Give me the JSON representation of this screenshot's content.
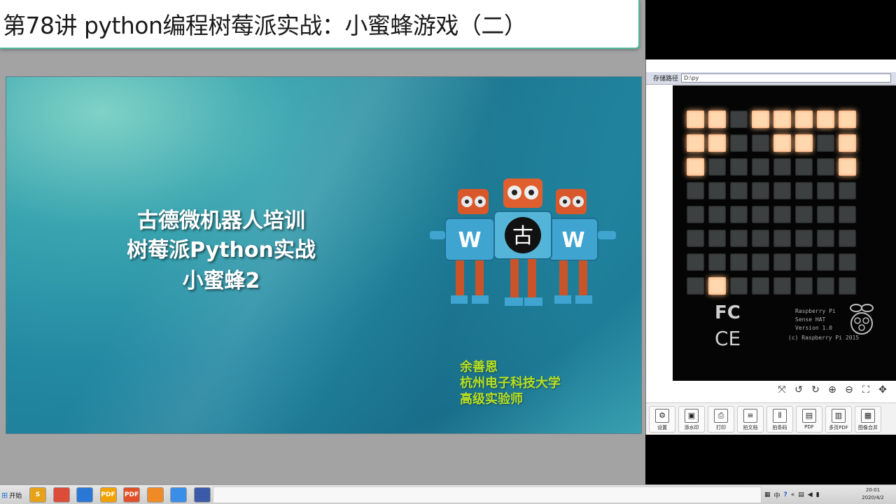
{
  "title_banner": {
    "text": "第78讲 python编程树莓派实战：小蜜蜂游戏（二）"
  },
  "slide": {
    "title_lines": [
      "古德微机器人培训",
      "树莓派Python实战",
      "小蜜蜂2"
    ],
    "author_lines": [
      "余善恩",
      "杭州电子科技大学",
      "高级实验师"
    ],
    "robot_badges": [
      "W",
      "古",
      "W"
    ]
  },
  "right_panel": {
    "path_label": "存储路径",
    "path_value": "D:\\py",
    "led_matrix": [
      [
        1,
        1,
        0,
        1,
        1,
        1,
        1,
        1
      ],
      [
        1,
        1,
        0,
        0,
        1,
        1,
        0,
        1
      ],
      [
        1,
        0,
        0,
        0,
        0,
        0,
        0,
        1
      ],
      [
        0,
        0,
        0,
        0,
        0,
        0,
        0,
        0
      ],
      [
        0,
        0,
        0,
        0,
        0,
        0,
        0,
        0
      ],
      [
        0,
        0,
        0,
        0,
        0,
        0,
        0,
        0
      ],
      [
        0,
        0,
        0,
        0,
        0,
        0,
        0,
        0
      ],
      [
        0,
        1,
        0,
        0,
        0,
        0,
        0,
        0
      ]
    ],
    "board_text": [
      "Raspberry Pi",
      "Sense HAT",
      "Version 1.0",
      "(c) Raspberry Pi 2015"
    ],
    "fcc_text": "FC",
    "ce_text": "CE",
    "view_tools": [
      "⤧",
      "↺",
      "↻",
      "⊕",
      "⊖",
      "⛶",
      "✥"
    ],
    "toolbar": [
      {
        "label": "设置",
        "icon": "gear-icon"
      },
      {
        "label": "添水印",
        "icon": "watermark-icon"
      },
      {
        "label": "打印",
        "icon": "printer-icon"
      },
      {
        "label": "拍文档",
        "icon": "document-icon"
      },
      {
        "label": "拍条码",
        "icon": "barcode-icon"
      },
      {
        "label": "PDF",
        "icon": "pdf-icon"
      },
      {
        "label": "多页PDF",
        "icon": "multipage-pdf-icon"
      },
      {
        "label": "图像合并",
        "icon": "merge-icon"
      }
    ]
  },
  "taskbar": {
    "start_label": "开始",
    "apps": [
      {
        "name": "sublime-icon",
        "label": "S",
        "color": "#e8a21a"
      },
      {
        "name": "chrome-icon",
        "label": "",
        "color": "#dd4b39"
      },
      {
        "name": "arrow-app-icon",
        "label": "",
        "color": "#2a78d6"
      },
      {
        "name": "pdf-reader-icon",
        "label": "PDF",
        "color": "#f2a200"
      },
      {
        "name": "pdf-icon",
        "label": "PDF",
        "color": "#e0502a"
      },
      {
        "name": "foxit-icon",
        "label": "",
        "color": "#f08a24"
      },
      {
        "name": "media-icon",
        "label": "",
        "color": "#3b8ee8"
      },
      {
        "name": "remote-icon",
        "label": "",
        "color": "#3b5aa8"
      }
    ],
    "tray": {
      "input_method": "中",
      "help": "?"
    },
    "clock": {
      "time": "20:01",
      "date": "2020/4/2"
    }
  }
}
